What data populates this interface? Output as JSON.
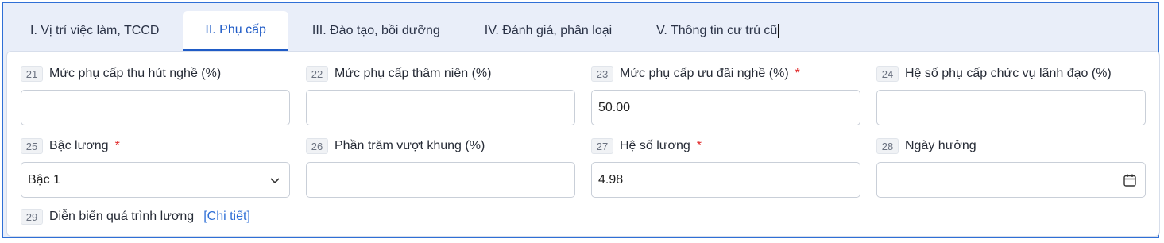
{
  "tabs": [
    {
      "label": "I. Vị trí việc làm, TCCD"
    },
    {
      "label": "II. Phụ cấp"
    },
    {
      "label": "III. Đào tạo, bồi dưỡng"
    },
    {
      "label": "IV. Đánh giá, phân loại"
    },
    {
      "label": "V. Thông tin cư trú cũ"
    }
  ],
  "fields": {
    "f21": {
      "num": "21",
      "label": "Mức phụ cấp thu hút nghề (%)",
      "value": ""
    },
    "f22": {
      "num": "22",
      "label": "Mức phụ cấp thâm niên (%)",
      "value": ""
    },
    "f23": {
      "num": "23",
      "label": "Mức phụ cấp ưu đãi nghề (%)",
      "value": "50.00",
      "required": "*"
    },
    "f24": {
      "num": "24",
      "label": "Hệ số phụ cấp chức vụ lãnh đạo (%)",
      "value": ""
    },
    "f25": {
      "num": "25",
      "label": "Bậc lương",
      "value": "Bậc 1",
      "required": "*"
    },
    "f26": {
      "num": "26",
      "label": "Phần trăm vượt khung (%)",
      "value": ""
    },
    "f27": {
      "num": "27",
      "label": "Hệ số lương",
      "value": "4.98",
      "required": "*"
    },
    "f28": {
      "num": "28",
      "label": "Ngày hưởng",
      "value": ""
    },
    "f29": {
      "num": "29",
      "label": "Diễn biến quá trình lương",
      "link": "[Chi tiết]"
    }
  },
  "icons": {
    "select_arrow": "chevron-down-icon",
    "date_picker": "calendar-icon"
  },
  "colors": {
    "accent": "#1f5bc6",
    "frame_border": "#2f6fd6",
    "required": "#e12a2a"
  }
}
